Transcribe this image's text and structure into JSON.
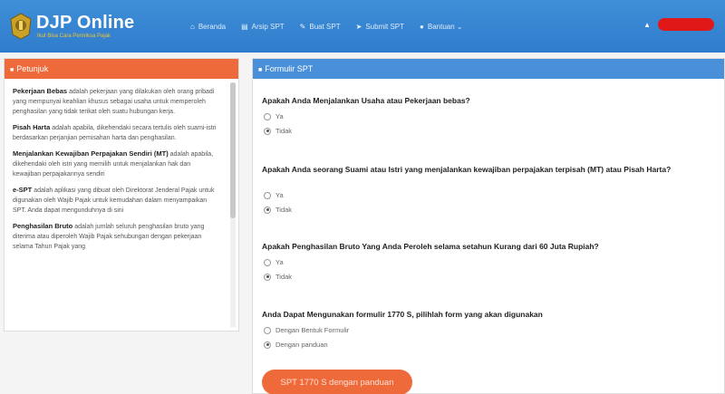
{
  "header": {
    "brand": "DJP Online",
    "tagline": "Ikut Bisa Cara Pemriksa Pajak",
    "nav": [
      {
        "icon": "home-icon",
        "glyph": "⌂",
        "label": "Beranda"
      },
      {
        "icon": "list-icon",
        "glyph": "▤",
        "label": "Arsip SPT"
      },
      {
        "icon": "edit-icon",
        "glyph": "✎",
        "label": "Buat SPT"
      },
      {
        "icon": "send-icon",
        "glyph": "➤",
        "label": "Submit SPT"
      },
      {
        "icon": "help-icon",
        "glyph": "●",
        "label": "Bantuan ⌄"
      }
    ],
    "user_icon": "user-icon"
  },
  "petunjuk": {
    "title": "Petunjuk",
    "items": [
      {
        "term": "Pekerjaan Bebas",
        "text": " adalah pekerjaan yang dilakukan oleh orang pribadi yang mempunyai keahlian khusus sebagai usaha untuk memperoleh penghasilan yang tidak terikat oleh suatu hubungan kerja."
      },
      {
        "term": "Pisah Harta",
        "text": " adalah apabila, dikehendaki secara tertulis oleh suami-istri berdasarkan perjanjian pemisahan harta dan penghasilan."
      },
      {
        "term": "Menjalankan Kewajiban Perpajakan Sendiri (MT)",
        "text": " adalah apabila, dikehendaki oleh istri yang memilih untuk menjalankan hak dan kewajiban perpajakannya sendiri"
      },
      {
        "term": "e-SPT",
        "text": " adalah aplikasi yang dibuat oleh Direktorat Jenderal Pajak untuk digunakan oleh Wajib Pajak untuk kemudahan dalam menyampaikan SPT. Anda dapat mengunduhnya di sini"
      },
      {
        "term": "Penghasilan Bruto",
        "text": " adalah jumlah seluruh penghasilan bruto yang diterima atau diperoleh Wajib Pajak sehubungan dengan pekerjaan selama Tahun Pajak yang"
      }
    ]
  },
  "form": {
    "title": "Formulir SPT",
    "questions": [
      {
        "text": "Apakah Anda Menjalankan Usaha atau Pekerjaan bebas?",
        "options": [
          "Ya",
          "Tidak"
        ],
        "selected": "Tidak"
      },
      {
        "text": "Apakah Anda seorang Suami atau Istri yang menjalankan kewajiban perpajakan terpisah (MT) atau Pisah Harta?",
        "options": [
          "Ya",
          "Tidak"
        ],
        "selected": "Tidak"
      },
      {
        "text": "Apakah Penghasilan Bruto Yang Anda Peroleh selama setahun Kurang dari 60 Juta Rupiah?",
        "options": [
          "Ya",
          "Tidak"
        ],
        "selected": "Tidak"
      },
      {
        "text": "Anda Dapat Mengunakan formulir 1770 S, pilihlah form yang akan digunakan",
        "options": [
          "Dengan Bentuk Formulir",
          "Dengan panduan"
        ],
        "selected": "Dengan panduan"
      }
    ],
    "submit_label": "SPT 1770 S dengan panduan"
  },
  "colors": {
    "nav_blue": "#3f8fd8",
    "accent_orange": "#ef6a3a",
    "panel_blue": "#4a8fd9"
  }
}
